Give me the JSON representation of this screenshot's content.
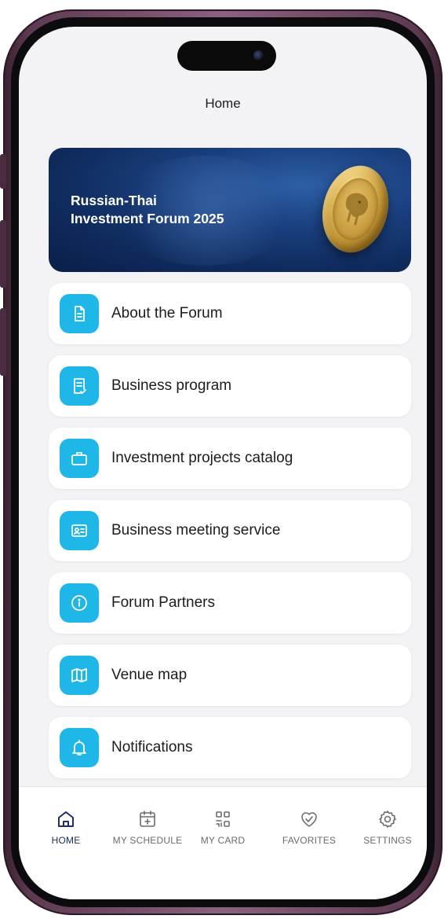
{
  "header": {
    "title": "Home"
  },
  "banner": {
    "title_line1": "Russian-Thai",
    "title_line2": "Investment Forum 2025"
  },
  "menu": [
    {
      "label": "About the Forum",
      "icon": "document-icon"
    },
    {
      "label": "Business program",
      "icon": "checklist-icon"
    },
    {
      "label": "Investment projects catalog",
      "icon": "briefcase-icon"
    },
    {
      "label": "Business meeting service",
      "icon": "id-card-icon"
    },
    {
      "label": "Forum Partners",
      "icon": "info-icon"
    },
    {
      "label": "Venue map",
      "icon": "map-icon"
    },
    {
      "label": "Notifications",
      "icon": "bell-icon"
    }
  ],
  "tabs": [
    {
      "label": "HOME",
      "icon": "home-icon",
      "active": true
    },
    {
      "label": "MY SCHEDULE",
      "icon": "calendar-plus-icon",
      "active": false
    },
    {
      "label": "MY CARD",
      "icon": "qr-code-icon",
      "active": false
    },
    {
      "label": "FAVORITES",
      "icon": "heart-icon",
      "active": false
    },
    {
      "label": "SETTINGS",
      "icon": "gear-icon",
      "active": false
    }
  ],
  "colors": {
    "accent": "#1fb6e8",
    "active_tab": "#1c2f66",
    "banner_bg": "#0f2a5c",
    "screen_bg": "#f3f3f5"
  }
}
